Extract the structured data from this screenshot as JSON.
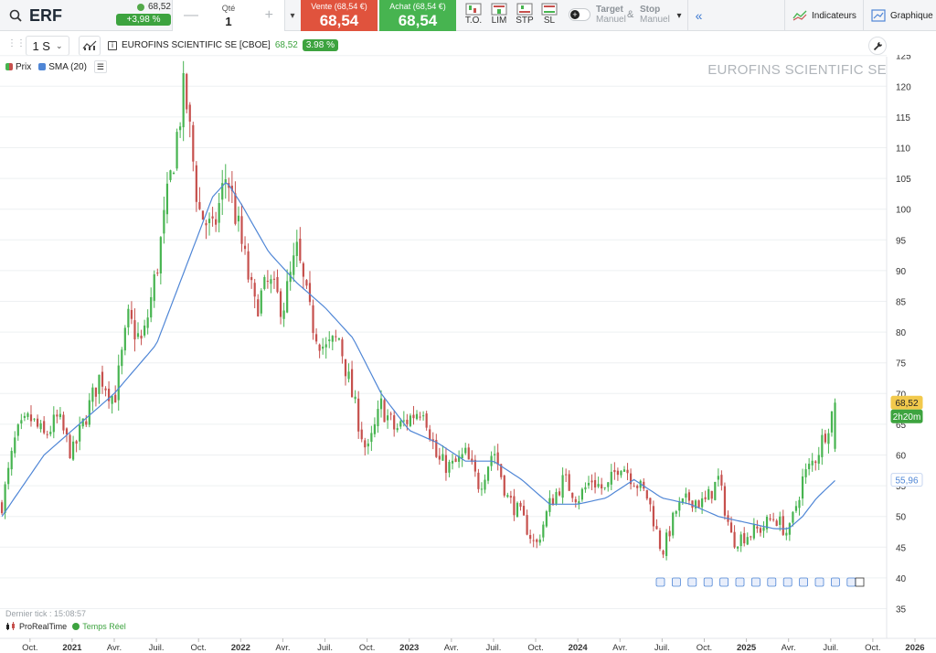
{
  "topbar": {
    "ticker": "ERF",
    "last": "68,52",
    "change_pct": "+3,98 %",
    "qty_label": "Qté",
    "qty_value": "1",
    "sell_label": "Vente (68,54 €)",
    "sell_price": "68,54",
    "buy_label": "Achat (68,54 €)",
    "buy_price": "68,54",
    "order_buttons": [
      "T.O.",
      "LIM",
      "STP",
      "SL"
    ],
    "target_label": "Target",
    "target_sub": "Manuel",
    "amp": "&",
    "stop_label": "Stop",
    "stop_sub": "Manuel",
    "indicators_label": "Indicateurs",
    "chart_label": "Graphique"
  },
  "chart_header": {
    "timeframe": "1 S",
    "instrument": "EUROFINS SCIENTIFIC SE [CBOE]",
    "last_price": "68,52",
    "change_pct": "3.98 %",
    "watermark": "EUROFINS SCIENTIFIC SE"
  },
  "legend": [
    {
      "label": "Prix",
      "color": "#47b450"
    },
    {
      "label": "SMA (20)",
      "color": "#4f86d6"
    }
  ],
  "footer": {
    "last_tick": "Dernier tick : 15:08:57",
    "provider": "ProRealTime",
    "realtime": "Temps Réel"
  },
  "colors": {
    "up": "#47b450",
    "down": "#c6504d",
    "sma": "#4f86d6",
    "price_tag": "#f2c94c",
    "timer_tag": "#3da33f"
  },
  "chart_data": {
    "type": "candlestick",
    "title": "EUROFINS SCIENTIFIC SE",
    "timeframe": "weekly",
    "ylim": [
      32,
      126
    ],
    "y_ticks": [
      35,
      40,
      45,
      50,
      55,
      60,
      65,
      70,
      75,
      80,
      85,
      90,
      95,
      100,
      105,
      110,
      115,
      120,
      125
    ],
    "x_tick_labels": [
      "Oct.",
      "2021",
      "Avr.",
      "Juil.",
      "Oct.",
      "2022",
      "Avr.",
      "Juil.",
      "Oct.",
      "2023",
      "Avr.",
      "Juil.",
      "Oct.",
      "2024",
      "Avr.",
      "Juil.",
      "Oct.",
      "2025",
      "Avr.",
      "Juil.",
      "Oct.",
      "2026"
    ],
    "bold_ticks": [
      "2021",
      "2022",
      "2023",
      "2024",
      "2025",
      "2026"
    ],
    "price_anchors": [
      {
        "date": "2020-08",
        "close": 52
      },
      {
        "date": "2020-09",
        "close": 63
      },
      {
        "date": "2020-10",
        "close": 66
      },
      {
        "date": "2020-11",
        "close": 63
      },
      {
        "date": "2020-12",
        "close": 66
      },
      {
        "date": "2021-01",
        "close": 60
      },
      {
        "date": "2021-03",
        "close": 73
      },
      {
        "date": "2021-04",
        "close": 69
      },
      {
        "date": "2021-05",
        "close": 82
      },
      {
        "date": "2021-06",
        "close": 78
      },
      {
        "date": "2021-07",
        "close": 90
      },
      {
        "date": "2021-08",
        "close": 105
      },
      {
        "date": "2021-09",
        "close": 120
      },
      {
        "date": "2021-10",
        "close": 100
      },
      {
        "date": "2021-11",
        "close": 96
      },
      {
        "date": "2021-12",
        "close": 106
      },
      {
        "date": "2022-01",
        "close": 95
      },
      {
        "date": "2022-02",
        "close": 84
      },
      {
        "date": "2022-03",
        "close": 88
      },
      {
        "date": "2022-04",
        "close": 84
      },
      {
        "date": "2022-05",
        "close": 93
      },
      {
        "date": "2022-06",
        "close": 82
      },
      {
        "date": "2022-07",
        "close": 77
      },
      {
        "date": "2022-08",
        "close": 79
      },
      {
        "date": "2022-09",
        "close": 69
      },
      {
        "date": "2022-10",
        "close": 60
      },
      {
        "date": "2022-11",
        "close": 68
      },
      {
        "date": "2022-12",
        "close": 64
      },
      {
        "date": "2023-01",
        "close": 66
      },
      {
        "date": "2023-02",
        "close": 68
      },
      {
        "date": "2023-03",
        "close": 59
      },
      {
        "date": "2023-04",
        "close": 58
      },
      {
        "date": "2023-05",
        "close": 60
      },
      {
        "date": "2023-06",
        "close": 55
      },
      {
        "date": "2023-07",
        "close": 61
      },
      {
        "date": "2023-08",
        "close": 53
      },
      {
        "date": "2023-09",
        "close": 50
      },
      {
        "date": "2023-10",
        "close": 45
      },
      {
        "date": "2023-11",
        "close": 52
      },
      {
        "date": "2023-12",
        "close": 56
      },
      {
        "date": "2024-01",
        "close": 53
      },
      {
        "date": "2024-02",
        "close": 56
      },
      {
        "date": "2024-03",
        "close": 54
      },
      {
        "date": "2024-04",
        "close": 59
      },
      {
        "date": "2024-05",
        "close": 56
      },
      {
        "date": "2024-06",
        "close": 53
      },
      {
        "date": "2024-07",
        "close": 44
      },
      {
        "date": "2024-08",
        "close": 51
      },
      {
        "date": "2024-09",
        "close": 53
      },
      {
        "date": "2024-10",
        "close": 52
      },
      {
        "date": "2024-11",
        "close": 56
      },
      {
        "date": "2024-12",
        "close": 46
      },
      {
        "date": "2025-01",
        "close": 47
      },
      {
        "date": "2025-02",
        "close": 48
      },
      {
        "date": "2025-03",
        "close": 50
      },
      {
        "date": "2025-04",
        "close": 47
      },
      {
        "date": "2025-05",
        "close": 56
      },
      {
        "date": "2025-06",
        "close": 60
      },
      {
        "date": "2025-07",
        "close": 68.52
      }
    ],
    "sma20_anchors": [
      {
        "date": "2020-08",
        "value": 50
      },
      {
        "date": "2020-11",
        "value": 60
      },
      {
        "date": "2021-01",
        "value": 64
      },
      {
        "date": "2021-04",
        "value": 70
      },
      {
        "date": "2021-07",
        "value": 78
      },
      {
        "date": "2021-09",
        "value": 90
      },
      {
        "date": "2021-11",
        "value": 102
      },
      {
        "date": "2021-12",
        "value": 104.5
      },
      {
        "date": "2022-01",
        "value": 101
      },
      {
        "date": "2022-03",
        "value": 93
      },
      {
        "date": "2022-05",
        "value": 88
      },
      {
        "date": "2022-07",
        "value": 84
      },
      {
        "date": "2022-09",
        "value": 79
      },
      {
        "date": "2022-11",
        "value": 70
      },
      {
        "date": "2023-01",
        "value": 64
      },
      {
        "date": "2023-03",
        "value": 62
      },
      {
        "date": "2023-05",
        "value": 59
      },
      {
        "date": "2023-07",
        "value": 59
      },
      {
        "date": "2023-09",
        "value": 56
      },
      {
        "date": "2023-11",
        "value": 52
      },
      {
        "date": "2024-01",
        "value": 52
      },
      {
        "date": "2024-03",
        "value": 53
      },
      {
        "date": "2024-05",
        "value": 56
      },
      {
        "date": "2024-07",
        "value": 53
      },
      {
        "date": "2024-09",
        "value": 52
      },
      {
        "date": "2024-11",
        "value": 50
      },
      {
        "date": "2025-01",
        "value": 49
      },
      {
        "date": "2025-03",
        "value": 48
      },
      {
        "date": "2025-04",
        "value": 48
      },
      {
        "date": "2025-05",
        "value": 50
      },
      {
        "date": "2025-06",
        "value": 53
      },
      {
        "date": "2025-07",
        "value": 55.96
      }
    ],
    "last_price_label": "68,52",
    "timer_label": "2h20m",
    "sma_label": "55,96",
    "event_marker_count": 13
  }
}
